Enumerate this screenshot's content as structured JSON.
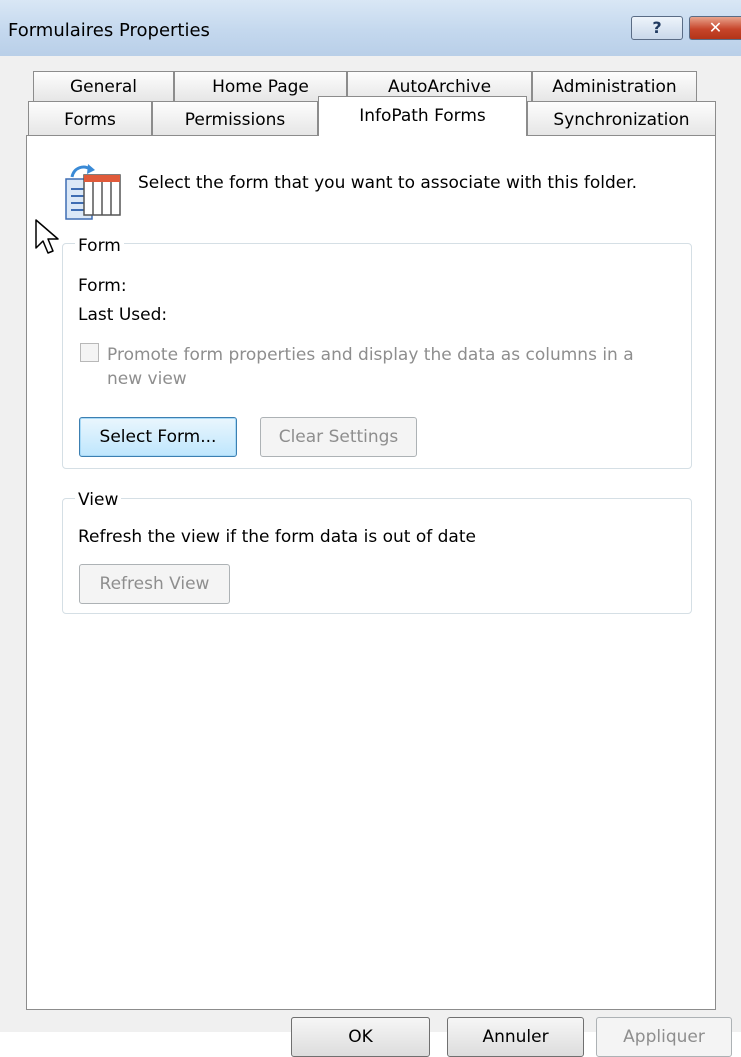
{
  "window": {
    "title": "Formulaires Properties",
    "help_label": "?",
    "close_label": "✕"
  },
  "tabs": {
    "row1": [
      "General",
      "Home Page",
      "AutoArchive",
      "Administration"
    ],
    "row2": [
      "Forms",
      "Permissions",
      "InfoPath Forms",
      "Synchronization"
    ],
    "active": "InfoPath Forms"
  },
  "panel": {
    "intro": "Select the form that you want to associate with this folder.",
    "form_group": {
      "legend": "Form",
      "form_label": "Form:",
      "last_used_label": "Last Used:",
      "promote_line1": "Promote form properties and display the data as columns in a",
      "promote_line2": "new view",
      "promote_checked": false,
      "select_button": "Select Form...",
      "clear_button": "Clear Settings"
    },
    "view_group": {
      "legend": "View",
      "refresh_text": "Refresh the view if the form data is out of date",
      "refresh_button": "Refresh View"
    }
  },
  "footer": {
    "ok": "OK",
    "cancel": "Annuler",
    "apply": "Appliquer"
  },
  "icons": {
    "form_icon": "infopath-form-icon",
    "cursor": "mouse-pointer-icon"
  }
}
